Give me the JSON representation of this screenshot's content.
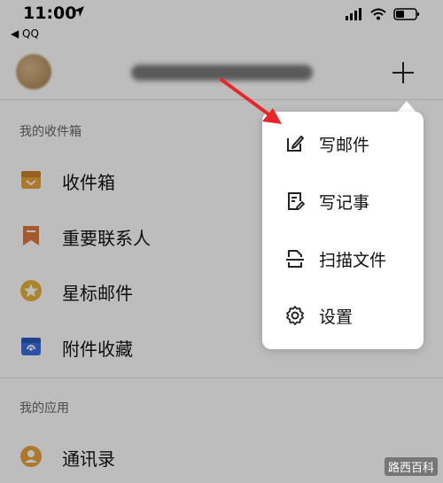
{
  "status_bar": {
    "time": "11:00",
    "back_label": "◀ QQ"
  },
  "sections": {
    "mailbox_title": "我的收件箱",
    "apps_title": "我的应用"
  },
  "mailbox_items": [
    {
      "label": "收件箱",
      "icon": "inbox-icon",
      "color": "#e8a23a"
    },
    {
      "label": "重要联系人",
      "icon": "bookmark-icon",
      "color": "#e07a3a"
    },
    {
      "label": "星标邮件",
      "icon": "star-icon",
      "color": "#e8b23a"
    },
    {
      "label": "附件收藏",
      "icon": "attachment-icon",
      "color": "#3a6fe0"
    }
  ],
  "app_items": [
    {
      "label": "通讯录",
      "icon": "contacts-icon",
      "color": "#e8a23a"
    }
  ],
  "menu": {
    "items": [
      {
        "label": "写邮件",
        "icon": "compose-icon"
      },
      {
        "label": "写记事",
        "icon": "note-icon"
      },
      {
        "label": "扫描文件",
        "icon": "scan-icon"
      },
      {
        "label": "设置",
        "icon": "settings-icon"
      }
    ]
  },
  "watermark": "路西百科",
  "colors": {
    "annotation_arrow": "#e8262a"
  }
}
